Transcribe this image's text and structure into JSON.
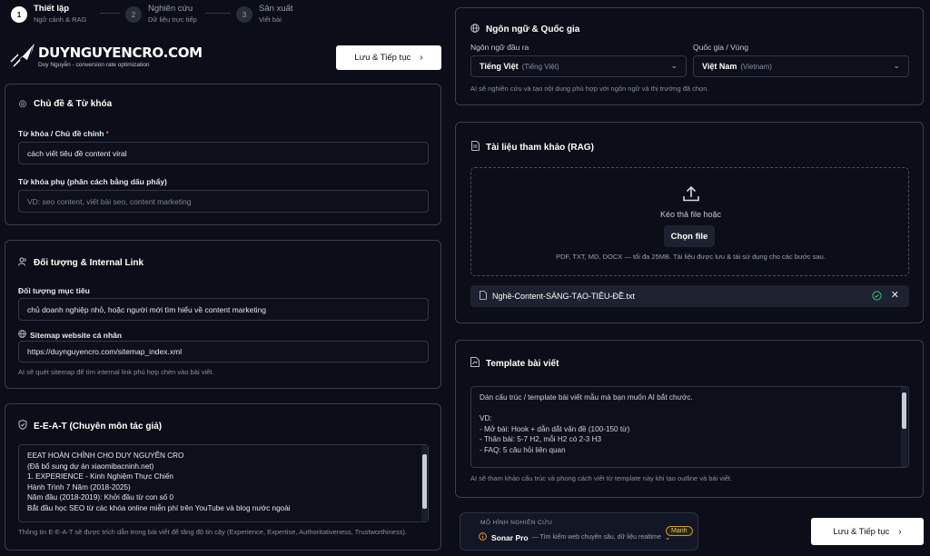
{
  "stepper": [
    {
      "num": "1",
      "title": "Thiết lập",
      "sub": "Ngữ cảnh & RAG"
    },
    {
      "num": "2",
      "title": "Nghiên cứu",
      "sub": "Dữ liệu trực tiếp"
    },
    {
      "num": "3",
      "title": "Sản xuất",
      "sub": "Viết bài"
    }
  ],
  "logo": {
    "text": "DUYNGUYENCRO.COM",
    "sub": "Duy Nguyễn - conversion rate optimization"
  },
  "save_continue": "Lưu & Tiếp tục",
  "topic": {
    "title": "Chủ đề & Từ khóa",
    "main_label": "Từ khóa / Chủ đề chính",
    "required": "*",
    "main_value": "cách viết tiêu đề content viral",
    "sub_label": "Từ khóa phụ (phân cách bằng dấu phẩy)",
    "sub_placeholder": "VD: seo content, viết bài seo, content marketing"
  },
  "audience": {
    "title": "Đối tượng & Internal Link",
    "target_label": "Đối tượng mục tiêu",
    "target_value": "chủ doanh nghiệp nhỏ, hoặc người mới tìm hiểu về content marketing",
    "sitemap_label": "Sitemap website cá nhân",
    "sitemap_value": "https://duynguyencro.com/sitemap_index.xml",
    "hint": "AI sẽ quét sitemap để tìm internal link phù hợp chèn vào bài viết."
  },
  "eeat": {
    "title": "E-E-A-T (Chuyên môn tác giả)",
    "content": "EEAT HOÀN CHỈNH CHO DUY NGUYỄN CRO\n(Đã bổ sung dự án xiaomibacninh.net)\n1. EXPERIENCE - Kinh Nghiệm Thực Chiến\nHành Trình 7 Năm (2018-2025)\nNăm đầu (2018-2019): Khởi đầu từ con số 0\nBắt đầu học SEO từ các khóa online miễn phí trên YouTube và blog nước ngoài",
    "hint": "Thông tin E-E-A-T sẽ được trích dẫn trong bài viết để tăng độ tin cậy (Experience, Expertise, Authoritativeness, Trustworthiness)."
  },
  "lang": {
    "title": "Ngôn ngữ & Quốc gia",
    "out_label": "Ngôn ngữ đầu ra",
    "out_value": "Tiếng Việt",
    "out_secondary": "(Tiếng Việt)",
    "country_label": "Quốc gia / Vùng",
    "country_value": "Việt Nam",
    "country_secondary": "(Vietnam)",
    "hint": "AI sẽ nghiên cứu và tạo nội dung phù hợp với ngôn ngữ và thị trường đã chọn."
  },
  "rag": {
    "title": "Tài liệu tham khảo (RAG)",
    "drop_text": "Kéo thả file hoặc",
    "choose_label": "Chọn file",
    "formats": "PDF, TXT, MD, DOCX — tối đa 25MB. Tài liệu được lưu & tái sử dụng cho các bước sau.",
    "file_name": "Nghề-Content-SÁNG-TẠO-TIÊU-ĐỀ.txt"
  },
  "template": {
    "title": "Template bài viết",
    "content": "Dán cấu trúc / template bài viết mẫu mà bạn muốn AI bắt chước.\n\nVD:\n- Mở bài: Hook + dẫn dắt vấn đề (100-150 từ)\n- Thân bài: 5-7 H2, mỗi H2 có 2-3 H3\n- FAQ: 5 câu hỏi liên quan",
    "hint": "AI sẽ tham khảo cấu trúc và phong cách viết từ template này khi tạo outline và bài viết."
  },
  "model": {
    "heading": "MÔ HÌNH NGHIÊN CỨU",
    "name": "Sonar Pro",
    "desc": "— Tìm kiếm web chuyên sâu, dữ liệu realtime",
    "badge": "Mạnh"
  }
}
